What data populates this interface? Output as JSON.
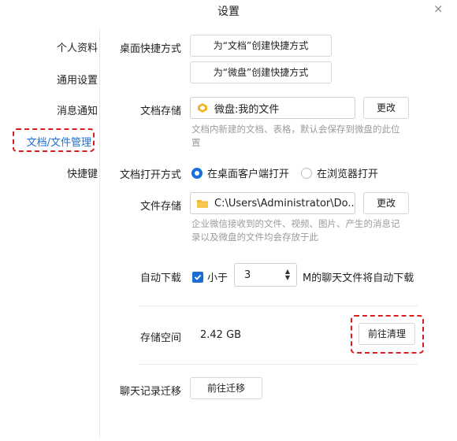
{
  "window": {
    "title": "设置",
    "close_glyph": "×"
  },
  "sidebar": {
    "items": [
      {
        "label": "个人资料"
      },
      {
        "label": "通用设置"
      },
      {
        "label": "消息通知"
      },
      {
        "label": "文档/文件管理",
        "active": true
      },
      {
        "label": "快捷键"
      }
    ]
  },
  "desktop_shortcut": {
    "label": "桌面快捷方式",
    "btn_docs": "为“文档”创建快捷方式",
    "btn_drive": "为“微盘”创建快捷方式"
  },
  "doc_storage": {
    "label": "文档存储",
    "path": "微盘:我的文件",
    "change": "更改",
    "help": "文档内新建的文档、表格，默认会保存到微盘的此位置"
  },
  "doc_open": {
    "label": "文档打开方式",
    "option_desktop": "在桌面客户端打开",
    "option_browser": "在浏览器打开",
    "selected": "desktop"
  },
  "file_storage": {
    "label": "文件存储",
    "path": "C:\\Users\\Administrator\\Do...",
    "change": "更改",
    "help": "企业微信接收到的文件、视频、图片、产生的消息记录以及微盘的文件均会存放于此"
  },
  "auto_download": {
    "label": "自动下载",
    "checked": true,
    "prefix": "小于",
    "value": "3",
    "suffix": "M的聊天文件将自动下载"
  },
  "storage": {
    "label": "存储空间",
    "size": "2.42 GB",
    "clean_button": "前往清理"
  },
  "chat_migrate": {
    "label": "聊天记录迁移",
    "button": "前往迁移"
  },
  "colors": {
    "accent": "#1a6fd6",
    "highlight_dash": "#d91c1c",
    "help_text": "#9b9b9b"
  }
}
